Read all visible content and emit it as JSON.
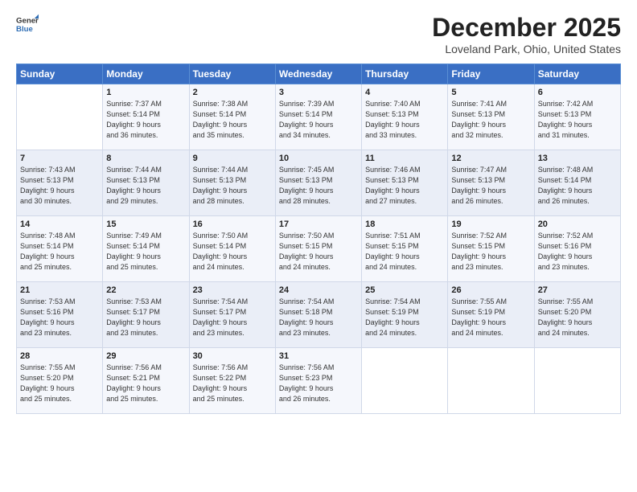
{
  "header": {
    "logo": {
      "general": "General",
      "blue": "Blue"
    },
    "title": "December 2025",
    "location": "Loveland Park, Ohio, United States"
  },
  "days_of_week": [
    "Sunday",
    "Monday",
    "Tuesday",
    "Wednesday",
    "Thursday",
    "Friday",
    "Saturday"
  ],
  "weeks": [
    [
      {
        "day": "",
        "content": ""
      },
      {
        "day": "1",
        "content": "Sunrise: 7:37 AM\nSunset: 5:14 PM\nDaylight: 9 hours\nand 36 minutes."
      },
      {
        "day": "2",
        "content": "Sunrise: 7:38 AM\nSunset: 5:14 PM\nDaylight: 9 hours\nand 35 minutes."
      },
      {
        "day": "3",
        "content": "Sunrise: 7:39 AM\nSunset: 5:14 PM\nDaylight: 9 hours\nand 34 minutes."
      },
      {
        "day": "4",
        "content": "Sunrise: 7:40 AM\nSunset: 5:13 PM\nDaylight: 9 hours\nand 33 minutes."
      },
      {
        "day": "5",
        "content": "Sunrise: 7:41 AM\nSunset: 5:13 PM\nDaylight: 9 hours\nand 32 minutes."
      },
      {
        "day": "6",
        "content": "Sunrise: 7:42 AM\nSunset: 5:13 PM\nDaylight: 9 hours\nand 31 minutes."
      }
    ],
    [
      {
        "day": "7",
        "content": "Sunrise: 7:43 AM\nSunset: 5:13 PM\nDaylight: 9 hours\nand 30 minutes."
      },
      {
        "day": "8",
        "content": "Sunrise: 7:44 AM\nSunset: 5:13 PM\nDaylight: 9 hours\nand 29 minutes."
      },
      {
        "day": "9",
        "content": "Sunrise: 7:44 AM\nSunset: 5:13 PM\nDaylight: 9 hours\nand 28 minutes."
      },
      {
        "day": "10",
        "content": "Sunrise: 7:45 AM\nSunset: 5:13 PM\nDaylight: 9 hours\nand 28 minutes."
      },
      {
        "day": "11",
        "content": "Sunrise: 7:46 AM\nSunset: 5:13 PM\nDaylight: 9 hours\nand 27 minutes."
      },
      {
        "day": "12",
        "content": "Sunrise: 7:47 AM\nSunset: 5:13 PM\nDaylight: 9 hours\nand 26 minutes."
      },
      {
        "day": "13",
        "content": "Sunrise: 7:48 AM\nSunset: 5:14 PM\nDaylight: 9 hours\nand 26 minutes."
      }
    ],
    [
      {
        "day": "14",
        "content": "Sunrise: 7:48 AM\nSunset: 5:14 PM\nDaylight: 9 hours\nand 25 minutes."
      },
      {
        "day": "15",
        "content": "Sunrise: 7:49 AM\nSunset: 5:14 PM\nDaylight: 9 hours\nand 25 minutes."
      },
      {
        "day": "16",
        "content": "Sunrise: 7:50 AM\nSunset: 5:14 PM\nDaylight: 9 hours\nand 24 minutes."
      },
      {
        "day": "17",
        "content": "Sunrise: 7:50 AM\nSunset: 5:15 PM\nDaylight: 9 hours\nand 24 minutes."
      },
      {
        "day": "18",
        "content": "Sunrise: 7:51 AM\nSunset: 5:15 PM\nDaylight: 9 hours\nand 24 minutes."
      },
      {
        "day": "19",
        "content": "Sunrise: 7:52 AM\nSunset: 5:15 PM\nDaylight: 9 hours\nand 23 minutes."
      },
      {
        "day": "20",
        "content": "Sunrise: 7:52 AM\nSunset: 5:16 PM\nDaylight: 9 hours\nand 23 minutes."
      }
    ],
    [
      {
        "day": "21",
        "content": "Sunrise: 7:53 AM\nSunset: 5:16 PM\nDaylight: 9 hours\nand 23 minutes."
      },
      {
        "day": "22",
        "content": "Sunrise: 7:53 AM\nSunset: 5:17 PM\nDaylight: 9 hours\nand 23 minutes."
      },
      {
        "day": "23",
        "content": "Sunrise: 7:54 AM\nSunset: 5:17 PM\nDaylight: 9 hours\nand 23 minutes."
      },
      {
        "day": "24",
        "content": "Sunrise: 7:54 AM\nSunset: 5:18 PM\nDaylight: 9 hours\nand 23 minutes."
      },
      {
        "day": "25",
        "content": "Sunrise: 7:54 AM\nSunset: 5:19 PM\nDaylight: 9 hours\nand 24 minutes."
      },
      {
        "day": "26",
        "content": "Sunrise: 7:55 AM\nSunset: 5:19 PM\nDaylight: 9 hours\nand 24 minutes."
      },
      {
        "day": "27",
        "content": "Sunrise: 7:55 AM\nSunset: 5:20 PM\nDaylight: 9 hours\nand 24 minutes."
      }
    ],
    [
      {
        "day": "28",
        "content": "Sunrise: 7:55 AM\nSunset: 5:20 PM\nDaylight: 9 hours\nand 25 minutes."
      },
      {
        "day": "29",
        "content": "Sunrise: 7:56 AM\nSunset: 5:21 PM\nDaylight: 9 hours\nand 25 minutes."
      },
      {
        "day": "30",
        "content": "Sunrise: 7:56 AM\nSunset: 5:22 PM\nDaylight: 9 hours\nand 25 minutes."
      },
      {
        "day": "31",
        "content": "Sunrise: 7:56 AM\nSunset: 5:23 PM\nDaylight: 9 hours\nand 26 minutes."
      },
      {
        "day": "",
        "content": ""
      },
      {
        "day": "",
        "content": ""
      },
      {
        "day": "",
        "content": ""
      }
    ]
  ]
}
